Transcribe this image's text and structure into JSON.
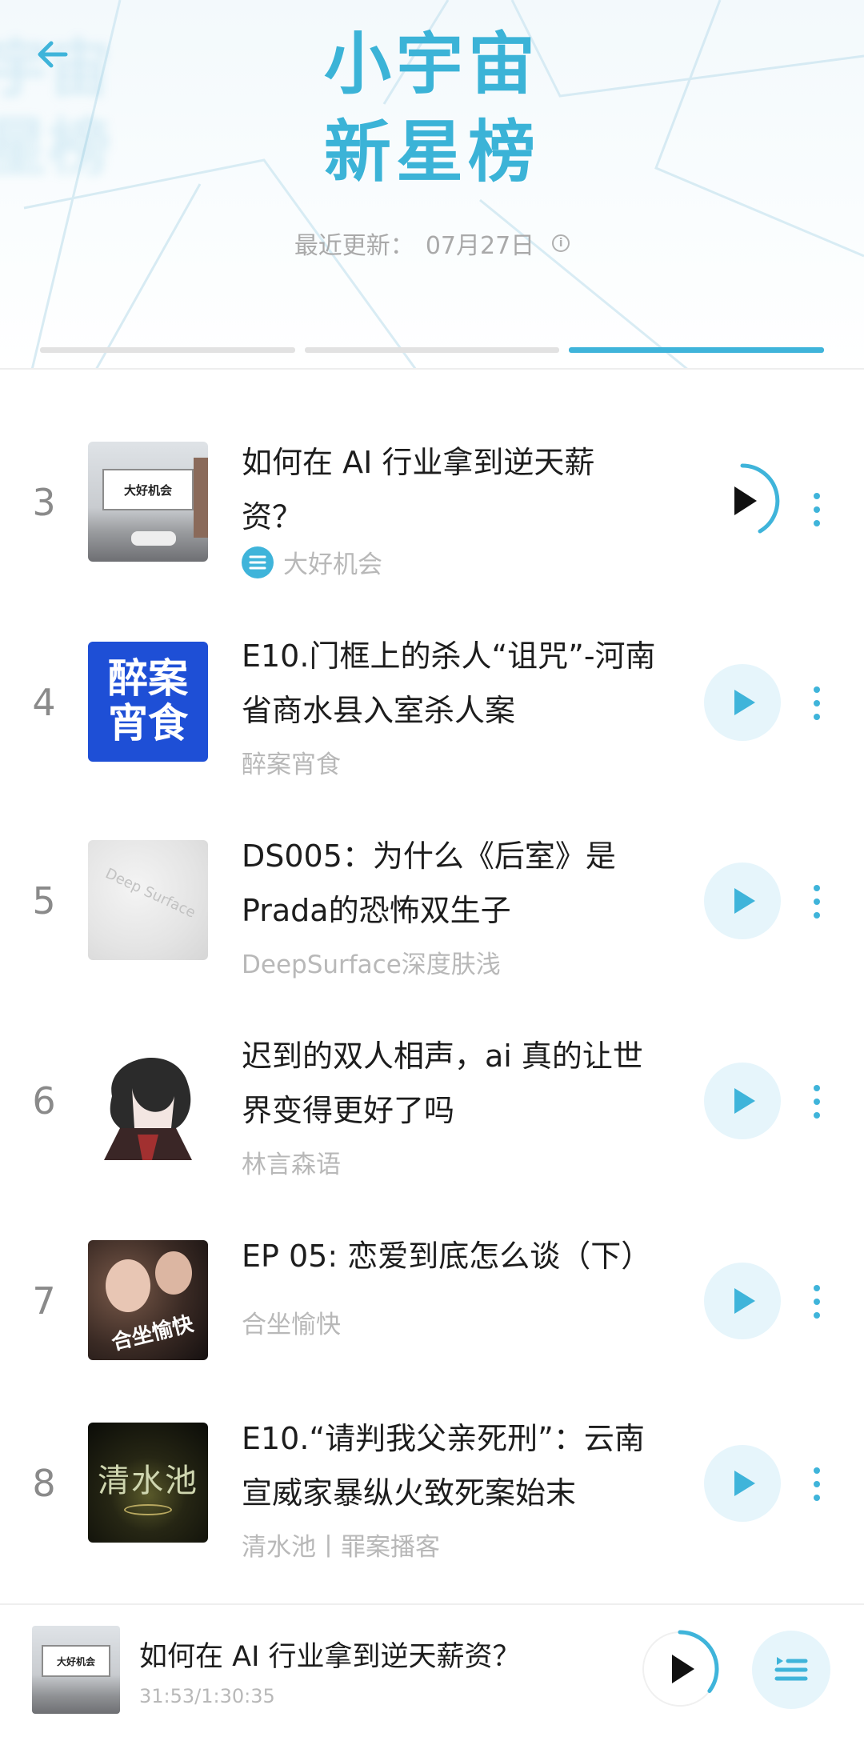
{
  "header": {
    "ghost_text_1": "宇宙",
    "ghost_text_2": "星榜",
    "title_line1": "小宇宙",
    "title_line2": "新星榜",
    "update_label": "最近更新：",
    "update_date": "07月27日"
  },
  "tabs": {
    "count": 3,
    "active_index": 2
  },
  "colors": {
    "accent": "#3fb4da",
    "title": "#3bb3d7",
    "play_bg": "#e6f5fb"
  },
  "items": [
    {
      "rank": "3",
      "title_line1": "如何在 AI 行业拿到逆天薪",
      "title_line2": "资？",
      "podcast": "大好机会",
      "cover_text": "大好机会",
      "playing": true
    },
    {
      "rank": "4",
      "title_line1": "E10.门框上的杀人“诅咒”-河南",
      "title_line2": "省商水县入室杀人案",
      "podcast": "醉案宵食",
      "cover_text_1": "醉案",
      "cover_text_2": "宵食"
    },
    {
      "rank": "5",
      "title_line1": "DS005：为什么《后室》是",
      "title_line2": "Prada的恐怖双生子",
      "podcast": "DeepSurface深度肤浅",
      "cover_text": "Deep Surface"
    },
    {
      "rank": "6",
      "title_line1": "迟到的双人相声，ai 真的让世",
      "title_line2": "界变得更好了吗",
      "podcast": "林言森语"
    },
    {
      "rank": "7",
      "title_line1": "EP 05: 恋爱到底怎么谈（下）",
      "title_line2": "",
      "podcast": "合坐愉快",
      "cover_text": "合坐愉快"
    },
    {
      "rank": "8",
      "title_line1": "E10.“请判我父亲死刑”：云南",
      "title_line2": "宣威家暴纵火致死案始末",
      "podcast": "清水池丨罪案播客",
      "cover_text": "清水池"
    }
  ],
  "player": {
    "title": "如何在 AI 行业拿到逆天薪资？",
    "time": "31:53/1:30:35",
    "progress": 0.352
  }
}
